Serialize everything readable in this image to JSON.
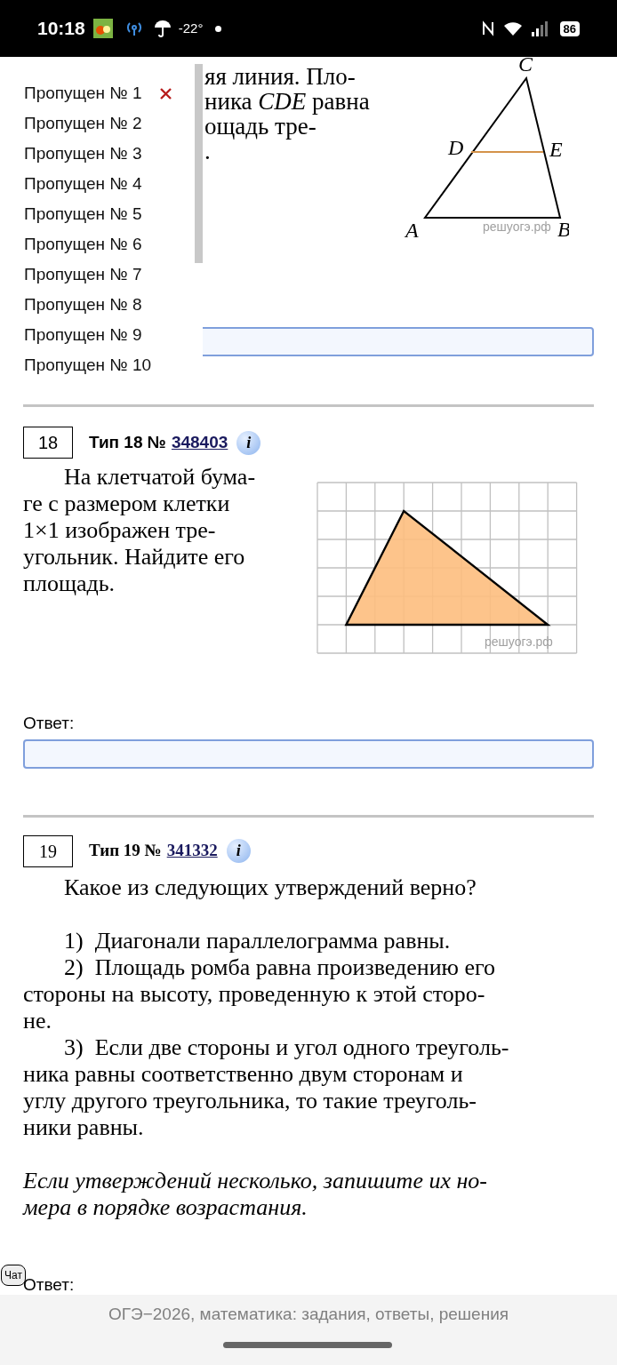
{
  "status_bar": {
    "time": "10:18",
    "temperature": "-22°",
    "battery": "86"
  },
  "skipped_panel": {
    "items": [
      {
        "label": "Пропущен № 1",
        "removable": true
      },
      {
        "label": "Пропущен № 2",
        "removable": false
      },
      {
        "label": "Пропущен № 3",
        "removable": false
      },
      {
        "label": "Пропущен № 4",
        "removable": false
      },
      {
        "label": "Пропущен № 5",
        "removable": false
      },
      {
        "label": "Пропущен № 6",
        "removable": false
      },
      {
        "label": "Пропущен № 7",
        "removable": false
      },
      {
        "label": "Пропущен № 8",
        "removable": false
      },
      {
        "label": "Пропущен № 9",
        "removable": false
      },
      {
        "label": "Пропущен № 10",
        "removable": false
      }
    ]
  },
  "task_17": {
    "text_lines": [
      "яя линия. Пло-",
      "ника *CDE* равна",
      "ощадь тре-",
      "."
    ],
    "figure": {
      "labels": [
        "C",
        "D",
        "E",
        "A",
        "B"
      ],
      "watermark": "решуогэ.рф"
    }
  },
  "tasks": [
    {
      "number": "18",
      "type_label": "Тип 18 №",
      "id": "348403",
      "info": "i",
      "text_lines": [
        "На клетчатой бума-",
        "ге с размером клетки",
        "1×1 изображен тре-",
        "угольник. Найдите его",
        "площадь."
      ],
      "figure": {
        "watermark": "решуогэ.рф"
      },
      "answer_label": "Ответ:"
    },
    {
      "number": "19",
      "type_label": "Тип 19 №",
      "id": "341332",
      "info": "i",
      "intro": "Какое из следующих утверждений верно?",
      "statements": [
        {
          "number": "1)",
          "lines": [
            "Диагонали параллелограмма равны."
          ]
        },
        {
          "number": "2)",
          "lines": [
            "Площадь ромба равна произведению его",
            "стороны на высоту, проведенную к этой сторо-",
            "не."
          ]
        },
        {
          "number": "3)",
          "lines": [
            "Если две стороны и угол одного треуголь-",
            "ника равны соответственно двум сторонам и",
            "углу другого треугольника, то такие треуголь-",
            "ники равны."
          ]
        }
      ],
      "note_lines": [
        "Если утверждений несколько, запишите их но-",
        "мера в порядке возрастания."
      ],
      "answer_label": "Ответ:"
    }
  ],
  "chat_button": "Чат",
  "footer": "ОГЭ−2026, математика: задания, ответы, решения"
}
